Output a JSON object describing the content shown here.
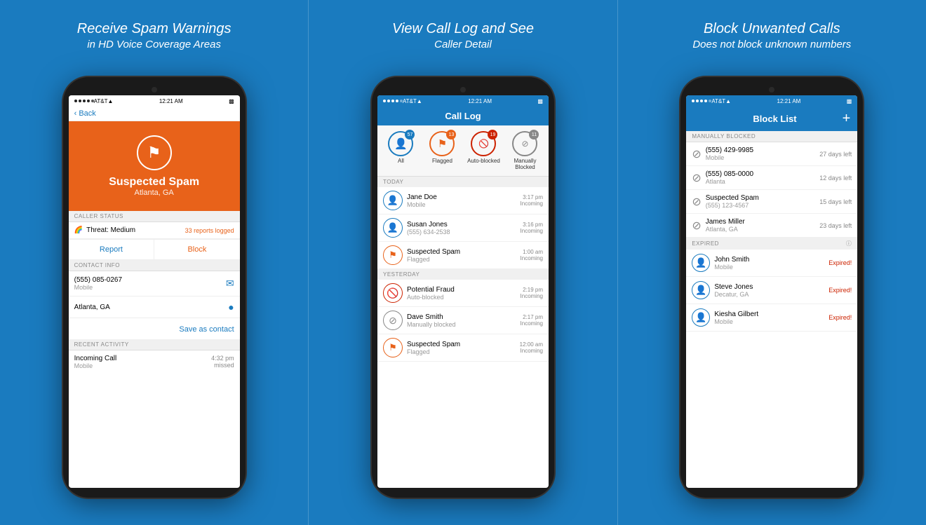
{
  "panels": [
    {
      "id": "panel-1",
      "title": "Receive Spam Warnings",
      "subtitle": "in HD Voice Coverage Areas",
      "phone": {
        "carrier": "AT&T",
        "time": "12:21 AM",
        "screen": "spam-detail",
        "nav_back": "Back",
        "spam_header": {
          "title": "Suspected Spam",
          "location": "Atlanta, GA"
        },
        "caller_status_label": "CALLER STATUS",
        "threat": "Threat: Medium",
        "reports": "33 reports logged",
        "report_btn": "Report",
        "block_btn": "Block",
        "contact_info_label": "CONTACT INFO",
        "phone_number": "(555) 085-0267",
        "phone_type": "Mobile",
        "location": "Atlanta, GA",
        "save_contact": "Save as contact",
        "recent_activity_label": "RECENT ACTIVITY",
        "recent_call": "Incoming Call",
        "recent_type": "Mobile",
        "recent_time": "4:32 pm",
        "recent_status": "missed"
      }
    },
    {
      "id": "panel-2",
      "title": "View Call Log and See",
      "subtitle": "Caller Detail",
      "phone": {
        "carrier": "AT&T",
        "time": "12:21 AM",
        "screen": "call-log",
        "nav_title": "Call Log",
        "filters": [
          {
            "label": "All",
            "badge": "57",
            "type": "blue"
          },
          {
            "label": "Flagged",
            "badge": "13",
            "type": "orange"
          },
          {
            "label": "Auto-blocked",
            "badge": "19",
            "type": "red"
          },
          {
            "label": "Manually Blocked",
            "badge": "11",
            "type": "gray"
          }
        ],
        "today_label": "TODAY",
        "today_calls": [
          {
            "name": "Jane Doe",
            "sub": "Mobile",
            "time": "3:17 pm",
            "direction": "Incoming",
            "type": "person"
          },
          {
            "name": "Susan Jones",
            "sub": "(555) 634-2538",
            "time": "3:16 pm",
            "direction": "Incoming",
            "type": "person"
          },
          {
            "name": "Suspected Spam",
            "sub": "Flagged",
            "time": "1:00 am",
            "direction": "Incoming",
            "type": "flag"
          }
        ],
        "yesterday_label": "YESTERDAY",
        "yesterday_calls": [
          {
            "name": "Potential Fraud",
            "sub": "Auto-blocked",
            "time": "2:19 pm",
            "direction": "Incoming",
            "type": "blocked"
          },
          {
            "name": "Dave Smith",
            "sub": "Manually blocked",
            "time": "2:17 pm",
            "direction": "Incoming",
            "type": "manual"
          },
          {
            "name": "Suspected Spam",
            "sub": "Flagged",
            "time": "12:00 am",
            "direction": "Incoming",
            "type": "flag"
          }
        ]
      }
    },
    {
      "id": "panel-3",
      "title": "Block Unwanted Calls",
      "subtitle": "Does not block unknown numbers",
      "phone": {
        "carrier": "AT&T",
        "time": "12:21 AM",
        "screen": "block-list",
        "nav_title": "Block List",
        "manually_blocked_label": "MANUALLY BLOCKED",
        "manually_blocked": [
          {
            "number": "(555) 429-9985",
            "type": "Mobile",
            "days": "27 days left"
          },
          {
            "number": "(555) 085-0000",
            "type": "Atlanta",
            "days": "12 days left"
          },
          {
            "number": "Suspected Spam",
            "type": "(555) 123-4567",
            "days": "15 days left"
          },
          {
            "number": "James Miller",
            "type": "Atlanta, GA",
            "days": "23 days left"
          }
        ],
        "expired_label": "EXPIRED",
        "expired": [
          {
            "name": "John Smith",
            "sub": "Mobile",
            "status": "Expired!"
          },
          {
            "name": "Steve Jones",
            "sub": "Decatur, GA",
            "status": "Expired!"
          },
          {
            "name": "Kiesha Gilbert",
            "sub": "Mobile",
            "status": "Expired!"
          }
        ]
      }
    }
  ]
}
